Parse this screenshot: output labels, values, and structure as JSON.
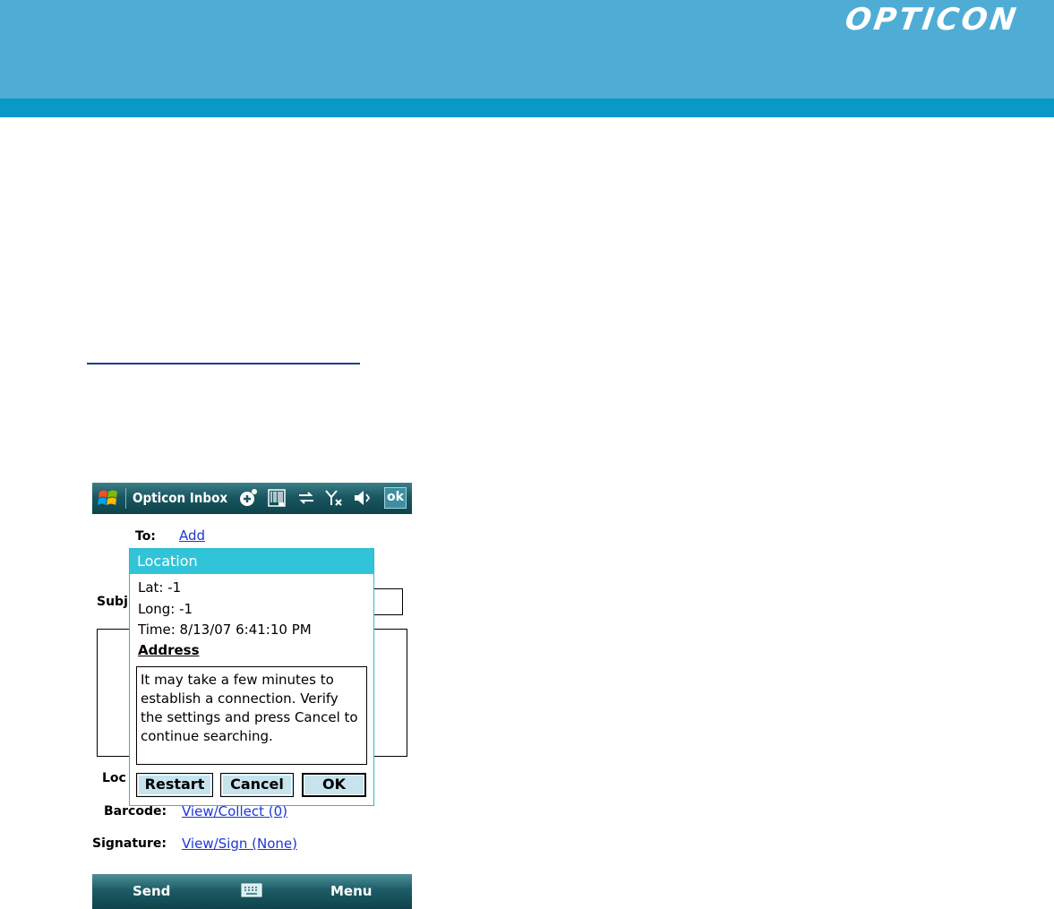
{
  "document": {
    "brand": "OPTICON",
    "colors": {
      "banner": "#4fadd5",
      "stripe": "#0899c9",
      "link": "#1d37d4",
      "popup_header": "#31c4d9"
    }
  },
  "device": {
    "titlebar": {
      "app_title": "Opticon Inbox",
      "ok_label": "ok",
      "status_icons": [
        "windows-start-icon",
        "new-message-icon",
        "barcode-scanner-icon",
        "sync-arrows-icon",
        "no-signal-icon",
        "speaker-icon"
      ]
    },
    "form": {
      "to_label": "To:",
      "to_link": "Add",
      "subject_label": "Subj",
      "location_label": "Loc",
      "barcode_label": "Barcode:",
      "barcode_link": "View/Collect (0)",
      "signature_label": "Signature:",
      "signature_link": "View/Sign (None)"
    },
    "popup": {
      "title": "Location",
      "lat": "Lat: -1",
      "long": "Long: -1",
      "time": "Time: 8/13/07 6:41:10 PM",
      "address_label": "Address",
      "message": "It may take a few minutes to establish a connection.  Verify the settings and press Cancel to continue searching.",
      "buttons": {
        "restart": "Restart",
        "cancel": "Cancel",
        "ok": "OK"
      }
    },
    "softbar": {
      "left": "Send",
      "right": "Menu",
      "center_icon": "keyboard-icon"
    }
  }
}
